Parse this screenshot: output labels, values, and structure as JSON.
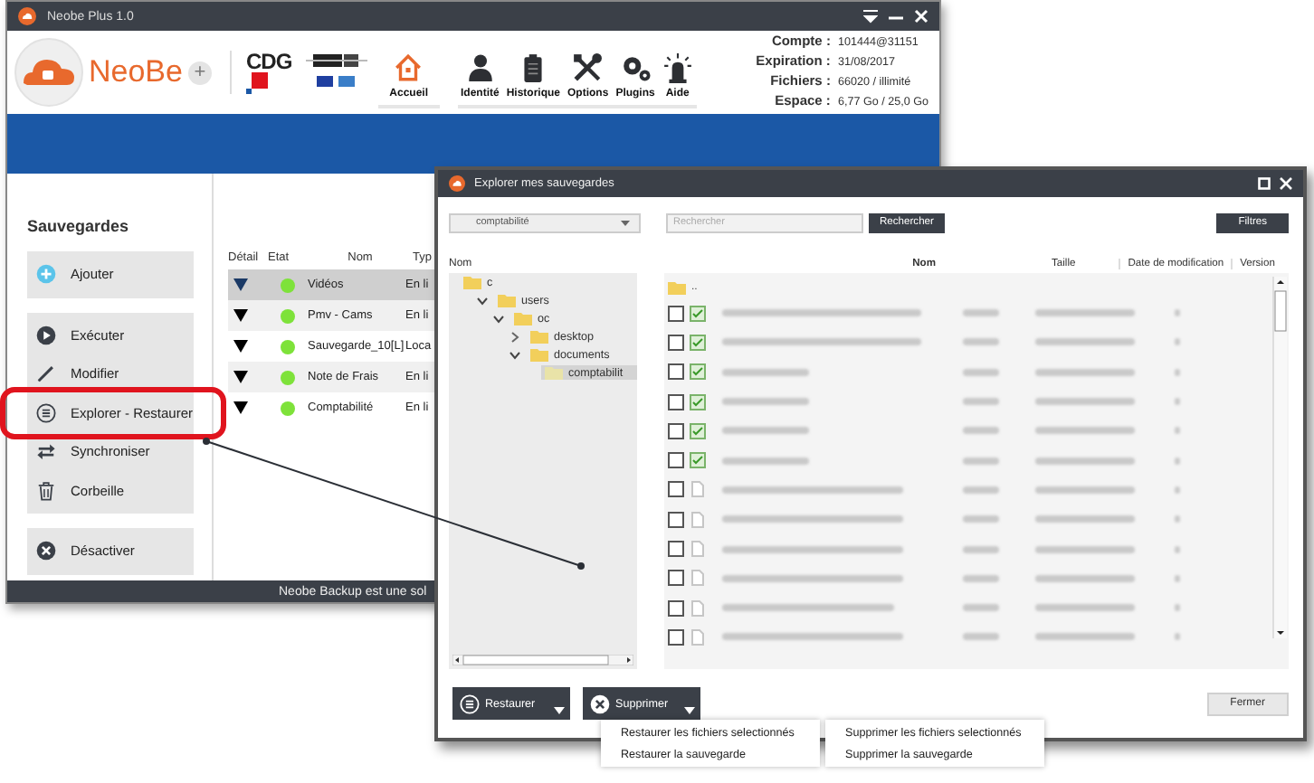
{
  "main_window": {
    "title": "Neobe Plus 1.0",
    "logo": {
      "name": "NeoBe",
      "suffix": "+"
    },
    "partner_logo": "CDG",
    "nav": [
      {
        "label": "Accueil",
        "selected": true
      },
      {
        "label": "Identité",
        "selected": false
      },
      {
        "label": "Historique",
        "selected": false
      },
      {
        "label": "Options",
        "selected": false
      },
      {
        "label": "Plugins",
        "selected": false
      },
      {
        "label": "Aide",
        "selected": false
      }
    ],
    "account": [
      {
        "label": "Compte :",
        "value": "101444@31151"
      },
      {
        "label": "Expiration :",
        "value": "31/08/2017"
      },
      {
        "label": "Fichiers :",
        "value": "66020 / illimité"
      },
      {
        "label": "Espace :",
        "value": "6,77 Go / 25,0 Go"
      }
    ],
    "sidebar": {
      "title": "Sauvegardes",
      "groups": [
        [
          {
            "label": "Ajouter",
            "highlighted": false
          }
        ],
        [
          {
            "label": "Exécuter",
            "highlighted": false
          },
          {
            "label": "Modifier",
            "highlighted": false
          },
          {
            "label": "Explorer - Restaurer",
            "highlighted": true
          },
          {
            "label": "Synchroniser",
            "highlighted": false
          },
          {
            "label": "Corbeille",
            "highlighted": false
          }
        ],
        [
          {
            "label": "Désactiver",
            "highlighted": false
          }
        ]
      ]
    },
    "table": {
      "columns": [
        "Détail",
        "Etat",
        "Nom",
        "Typ"
      ],
      "rows": [
        {
          "name": "Vidéos",
          "type": "En li",
          "selected": true
        },
        {
          "name": "Pmv - Cams",
          "type": "En li",
          "selected": false
        },
        {
          "name": "Sauvegarde_10[L]",
          "type": "Loca",
          "selected": false
        },
        {
          "name": "Note de Frais",
          "type": "En li",
          "selected": false
        },
        {
          "name": "Comptabilité",
          "type": "En li",
          "selected": false
        }
      ]
    },
    "status_bar": "Neobe Backup est une sol"
  },
  "explorer_window": {
    "title": "Explorer mes sauvegardes",
    "backup_select": "comptabilité",
    "search": {
      "placeholder": "Rechercher"
    },
    "search_button": "Rechercher",
    "filter_button": "Filtres",
    "tree": {
      "header": "Nom",
      "items": [
        {
          "label": "c",
          "selected": false,
          "children": [
            {
              "label": "users",
              "expanded": true,
              "selected": false,
              "children": [
                {
                  "label": "oc",
                  "expanded": true,
                  "selected": false,
                  "children": [
                    {
                      "label": "desktop",
                      "expanded": false,
                      "selected": false
                    },
                    {
                      "label": "documents",
                      "expanded": true,
                      "selected": false,
                      "children": [
                        {
                          "label": "comptabilit",
                          "selected": true
                        }
                      ]
                    }
                  ]
                }
              ]
            }
          ]
        }
      ]
    },
    "columns": [
      "Nom",
      "Taille",
      "Date de modification",
      "Version"
    ],
    "parent_row": "..",
    "files": [
      {
        "kind": "spreadsheet",
        "checked": false
      },
      {
        "kind": "spreadsheet",
        "checked": false
      },
      {
        "kind": "spreadsheet",
        "checked": false
      },
      {
        "kind": "spreadsheet",
        "checked": false
      },
      {
        "kind": "spreadsheet",
        "checked": false
      },
      {
        "kind": "spreadsheet",
        "checked": false
      },
      {
        "kind": "document",
        "checked": false
      },
      {
        "kind": "document",
        "checked": false
      },
      {
        "kind": "document",
        "checked": false
      },
      {
        "kind": "document",
        "checked": false
      },
      {
        "kind": "document",
        "checked": false
      },
      {
        "kind": "document",
        "checked": false
      }
    ],
    "actions": [
      {
        "label": "Restaurer",
        "menu": [
          "Restaurer les fichiers selectionnés",
          "Restaurer la sauvegarde"
        ]
      },
      {
        "label": "Supprimer",
        "menu": [
          "Supprimer les fichiers selectionnés",
          "Supprimer la sauvegarde"
        ]
      }
    ],
    "close_button": "Fermer"
  }
}
